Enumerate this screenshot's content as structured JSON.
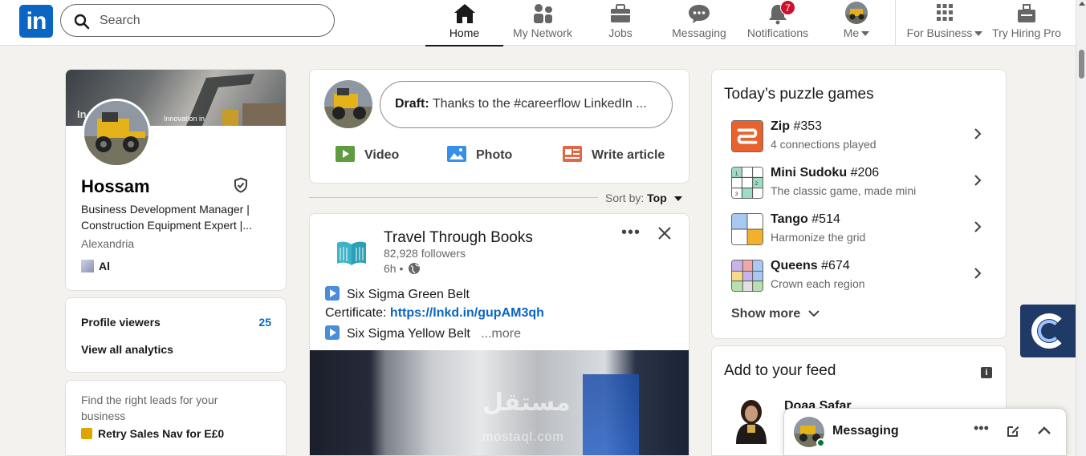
{
  "nav": {
    "search_placeholder": "Search",
    "home": "Home",
    "network": "My Network",
    "jobs": "Jobs",
    "messaging": "Messaging",
    "notifications": "Notifications",
    "notifications_count": "7",
    "me": "Me",
    "for_business": "For Business",
    "try_hiring": "Try Hiring Pro"
  },
  "profile": {
    "cover_text_large": "In",
    "cover_text_small": "Innovation in",
    "name": "Hossam",
    "headline": "Business Development Manager | Construction Equipment Expert |...",
    "location": "Alexandria",
    "org": "Al"
  },
  "stats": {
    "viewers_label": "Profile viewers",
    "viewers_value": "25",
    "analytics_label": "View all analytics"
  },
  "promo": {
    "text": "Find the right leads for your business",
    "cta": "Retry Sales Nav for E£0"
  },
  "composer": {
    "draft_label": "Draft:",
    "draft_text": "Thanks to the #careerflow LinkedIn ...",
    "video": "Video",
    "photo": "Photo",
    "article": "Write article"
  },
  "sort": {
    "label": "Sort by:",
    "value": "Top"
  },
  "post": {
    "author": "Travel Through Books",
    "followers": "82,928 followers",
    "time": "6h •",
    "line1": "Six Sigma Green Belt",
    "line2_prefix": "Certificate:",
    "line2_link": "https://lnkd.in/gupAM3qh",
    "line3": "Six Sigma Yellow Belt",
    "more": "...more",
    "watermark": "مستقل",
    "watermark_latin": "mostaql.com"
  },
  "puzzles": {
    "title": "Today’s puzzle games",
    "games": [
      {
        "name": "Zip",
        "number": "#353",
        "sub": "4 connections played"
      },
      {
        "name": "Mini Sudoku",
        "number": "#206",
        "sub": "The classic game, made mini"
      },
      {
        "name": "Tango",
        "number": "#514",
        "sub": "Harmonize the grid"
      },
      {
        "name": "Queens",
        "number": "#674",
        "sub": "Crown each region"
      }
    ],
    "show_more": "Show more"
  },
  "feed": {
    "title": "Add to your feed",
    "person": "Doaa Safar"
  },
  "messaging_bar": {
    "label": "Messaging"
  },
  "colors": {
    "brand": "#0a66c2",
    "badge": "#cb112d",
    "background": "#f4f2ee"
  }
}
